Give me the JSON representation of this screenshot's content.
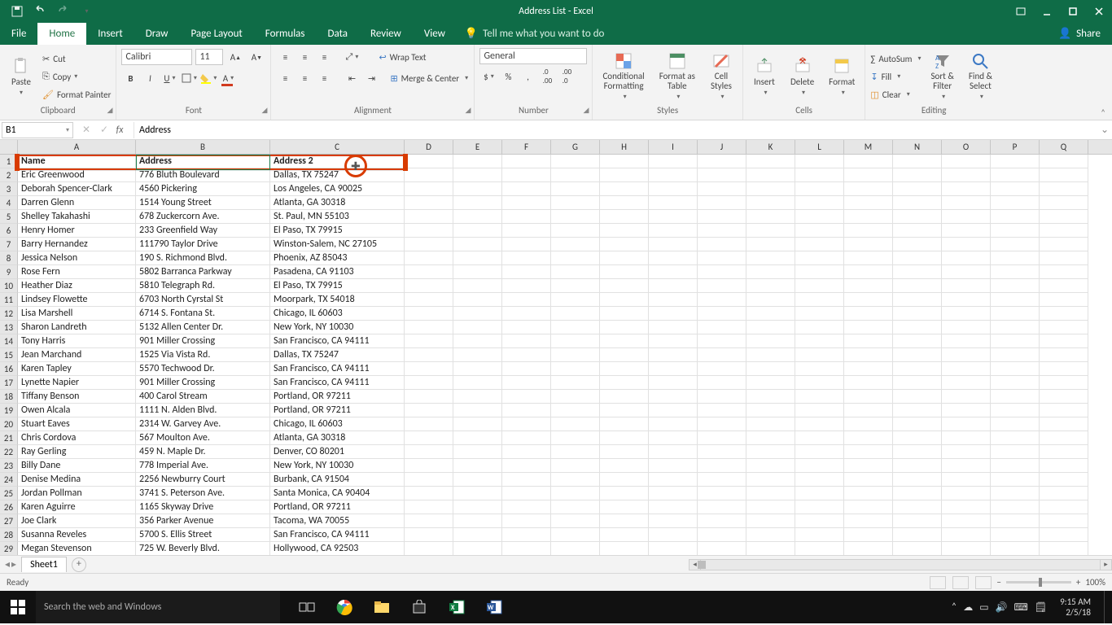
{
  "window": {
    "title": "Address List  -  Excel"
  },
  "tabs": {
    "items": [
      "File",
      "Home",
      "Insert",
      "Draw",
      "Page Layout",
      "Formulas",
      "Data",
      "Review",
      "View"
    ],
    "active_index": 1,
    "tell_me": "Tell me what you want to do",
    "share": "Share"
  },
  "ribbon": {
    "clipboard": {
      "paste": "Paste",
      "cut": "Cut",
      "copy": "Copy",
      "painter": "Format Painter",
      "label": "Clipboard"
    },
    "font": {
      "name": "Calibri",
      "size": "11",
      "label": "Font"
    },
    "alignment": {
      "wrap": "Wrap Text",
      "merge": "Merge & Center",
      "label": "Alignment"
    },
    "number": {
      "format": "General",
      "label": "Number"
    },
    "styles": {
      "cond": "Conditional Formatting",
      "table": "Format as Table",
      "cell": "Cell Styles",
      "label": "Styles"
    },
    "cells": {
      "insert": "Insert",
      "delete": "Delete",
      "format": "Format",
      "label": "Cells"
    },
    "editing": {
      "autosum": "AutoSum",
      "fill": "Fill",
      "clear": "Clear",
      "sort": "Sort & Filter",
      "find": "Find & Select",
      "label": "Editing"
    }
  },
  "formula_bar": {
    "ref": "B1",
    "formula": "Address"
  },
  "columns": {
    "letters": [
      "A",
      "B",
      "C",
      "D",
      "E",
      "F",
      "G",
      "H",
      "I",
      "J",
      "K",
      "L",
      "M",
      "N",
      "O",
      "P",
      "Q"
    ],
    "colA_w": 145,
    "colB_w": 165,
    "colC_w": 165,
    "rest_w": 60
  },
  "headers": [
    "Name",
    "Address",
    "Address 2"
  ],
  "data": [
    [
      "Eric Greenwood",
      "776 Bluth Boulevard",
      "Dallas, TX 75247"
    ],
    [
      "Deborah Spencer-Clark",
      "4560 Pickering",
      "Los Angeles, CA 90025"
    ],
    [
      "Darren Glenn",
      "1514 Young Street",
      "Atlanta, GA 30318"
    ],
    [
      "Shelley Takahashi",
      "678 Zuckercorn Ave.",
      "St. Paul, MN 55103"
    ],
    [
      "Henry Homer",
      "233 Greenfield Way",
      "El Paso, TX 79915"
    ],
    [
      "Barry Hernandez",
      "111790 Taylor Drive",
      "Winston-Salem, NC 27105"
    ],
    [
      "Jessica Nelson",
      "190 S. Richmond Blvd.",
      "Phoenix, AZ 85043"
    ],
    [
      "Rose Fern",
      "5802 Barranca Parkway",
      "Pasadena, CA 91103"
    ],
    [
      "Heather Diaz",
      "5810 Telegraph Rd.",
      "El Paso, TX 79915"
    ],
    [
      "Lindsey Flowette",
      "6703 North Cyrstal St",
      "Moorpark, TX 54018"
    ],
    [
      "Lisa Marshell",
      "6714 S. Fontana St.",
      "Chicago, IL 60603"
    ],
    [
      "Sharon Landreth",
      "5132 Allen Center Dr.",
      "New York, NY 10030"
    ],
    [
      "Tony Harris",
      "901 Miller Crossing",
      "San Francisco, CA 94111"
    ],
    [
      "Jean Marchand",
      "1525 Via Vista Rd.",
      "Dallas, TX 75247"
    ],
    [
      "Karen Tapley",
      "5570 Techwood Dr.",
      "San Francisco, CA 94111"
    ],
    [
      "Lynette Napier",
      "901 Miller Crossing",
      "San Francisco, CA 94111"
    ],
    [
      "Tiffany Benson",
      "400 Carol Stream",
      "Portland, OR 97211"
    ],
    [
      "Owen Alcala",
      "1111 N. Alden Blvd.",
      "Portland, OR 97211"
    ],
    [
      "Stuart Eaves",
      "2314 W. Garvey Ave.",
      "Chicago, IL 60603"
    ],
    [
      "Chris Cordova",
      "567 Moulton Ave.",
      "Atlanta, GA 30318"
    ],
    [
      "Ray Gerling",
      "459 N. Maple Dr.",
      "Denver, CO 80201"
    ],
    [
      "Billy Dane",
      "778 Imperial Ave.",
      "New York, NY 10030"
    ],
    [
      "Denise Medina",
      "2256 Newburry Court",
      "Burbank, CA 91504"
    ],
    [
      "Jordan Pollman",
      "3741 S. Peterson Ave.",
      "Santa Monica, CA 90404"
    ],
    [
      "Karen Aguirre",
      "1165 Skyway Drive",
      "Portland, OR 97211"
    ],
    [
      "Joe Clark",
      "356 Parker Avenue",
      "Tacoma, WA 70055"
    ],
    [
      "Susanna Reveles",
      "5700 S. Ellis Street",
      "San Francisco, CA 94111"
    ],
    [
      "Megan Stevenson",
      "725 W. Beverly Blvd.",
      "Hollywood, CA 92503"
    ]
  ],
  "sheet": {
    "name": "Sheet1"
  },
  "status": {
    "ready": "Ready",
    "zoom": "100%"
  },
  "taskbar": {
    "search": "Search the web and Windows",
    "time": "9:15 AM",
    "date": "2/5/18"
  }
}
